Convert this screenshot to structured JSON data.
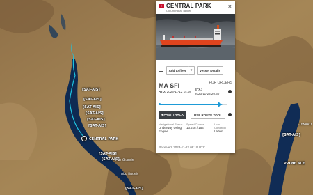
{
  "map": {
    "sat_labels": [
      "[SAT-AIS]",
      "[SAT-AIS]",
      "[SAT-AIS]",
      "[SAT-AIS]",
      "[SAT-AIS]",
      "[SAT-AIS]",
      "[SAT-AIS]",
      "[SAT-AIS]",
      "[SAT-AIS]",
      "[SAT-AIS]"
    ],
    "place_labels": [
      "Abu Rudeis",
      "Mar Grande",
      "EDWARD"
    ],
    "vessel_label": "CENTRAL PARK",
    "other_vessel_label": "PRIME ACE"
  },
  "popup": {
    "name": "CENTRAL PARK",
    "type": "Oil/Chemical Tanker",
    "close": "×",
    "add_to_fleet": "Add to fleet",
    "caret": "▾",
    "vessel_details": "Vessel Details",
    "destination": "MA SFI",
    "destination_note": "FOR ORDERS",
    "atd_label": "ATD:",
    "atd_value": "2023-11-12 14:08",
    "eta_label": "ETA:",
    "eta_value": "2023-11-23 20:30",
    "info": "i",
    "voyage_progress": 0.9,
    "past_track": "◂ PAST TRACK",
    "route_tool": "USE ROUTE TOOL",
    "nav_status_label": "Navigational Status",
    "nav_status_value": "Underway Using Engine",
    "speed_label": "Speed/Course",
    "speed_value": "13.2kn / 154°",
    "load_label": "Load Condition",
    "load_value": "Laden",
    "received": "Received: 2023-11-22 08:19 UTC"
  },
  "colors": {
    "sea": "#0e2a52",
    "route": "#1ec4e0",
    "accent": "#1e9bd7",
    "ship_hull": "#e0441e"
  }
}
